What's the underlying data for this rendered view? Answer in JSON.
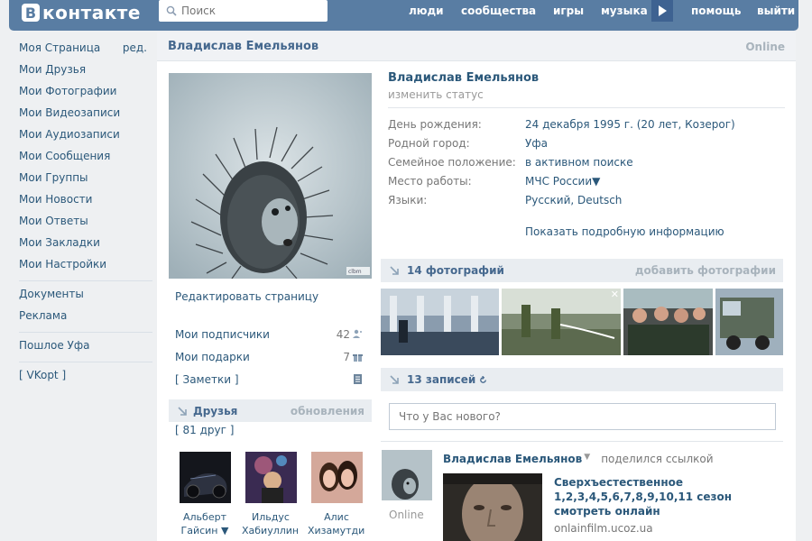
{
  "header": {
    "logo_letter": "В",
    "logo_text": "контакте",
    "search_placeholder": "Поиск",
    "nav": [
      "люди",
      "сообщества",
      "игры",
      "музыка",
      "помощь",
      "выйти"
    ],
    "brand_color": "#597da3"
  },
  "sidebar": {
    "edit_label": "ред.",
    "items": [
      "Моя Страница",
      "Мои Друзья",
      "Мои Фотографии",
      "Мои Видеозаписи",
      "Мои Аудиозаписи",
      "Мои Сообщения",
      "Мои Группы",
      "Мои Новости",
      "Мои Ответы",
      "Мои Закладки",
      "Мои Настройки"
    ],
    "items2": [
      "Документы",
      "Реклама"
    ],
    "items3": [
      "Пошлое Уфа"
    ],
    "items4": [
      "[ VKopt ]"
    ]
  },
  "profile": {
    "header_name": "Владислав Емельянов",
    "online": "Online",
    "name": "Владислав Емельянов",
    "status_link": "изменить статус",
    "edit_page": "Редактировать страницу",
    "followers_label": "Мои подписчики",
    "followers_count": "42",
    "gifts_label": "Мои подарки",
    "gifts_count": "7",
    "notes_label": "[ Заметки ]",
    "info": [
      {
        "k": "День рождения:",
        "v": "24 декабря 1995 г. (20 лет, Козерог)"
      },
      {
        "k": "Родной город:",
        "v": "Уфа"
      },
      {
        "k": "Семейное положение:",
        "v": "в активном поиске"
      },
      {
        "k": "Место работы:",
        "v": "МЧС России▼"
      },
      {
        "k": "Языки:",
        "v": "Русский, Deutsch"
      }
    ],
    "more_info": "Показать подробную информацию"
  },
  "friends": {
    "title": "Друзья",
    "updates": "обновления",
    "count": "[ 81 друг ]",
    "list": [
      {
        "first": "Альберт",
        "last": "Гайсин ▼"
      },
      {
        "first": "Ильдус",
        "last": "Хабиуллин ▼"
      },
      {
        "first": "Алис",
        "last": "Хизамутдинов ▼"
      }
    ]
  },
  "photos": {
    "title": "14 фотографий",
    "add": "добавить фотографии",
    "close": "✕"
  },
  "wall": {
    "title": "13 записей",
    "placeholder": "Что у Вас нового?",
    "post": {
      "author": "Владислав Емельянов",
      "action": "поделился ссылкой",
      "online": "Online",
      "link_title": "Сверхъестественное 1,2,3,4,5,6,7,8,9,10,11 сезон смотреть онлайн",
      "site": "onlainfilm.ucoz.ua"
    }
  }
}
